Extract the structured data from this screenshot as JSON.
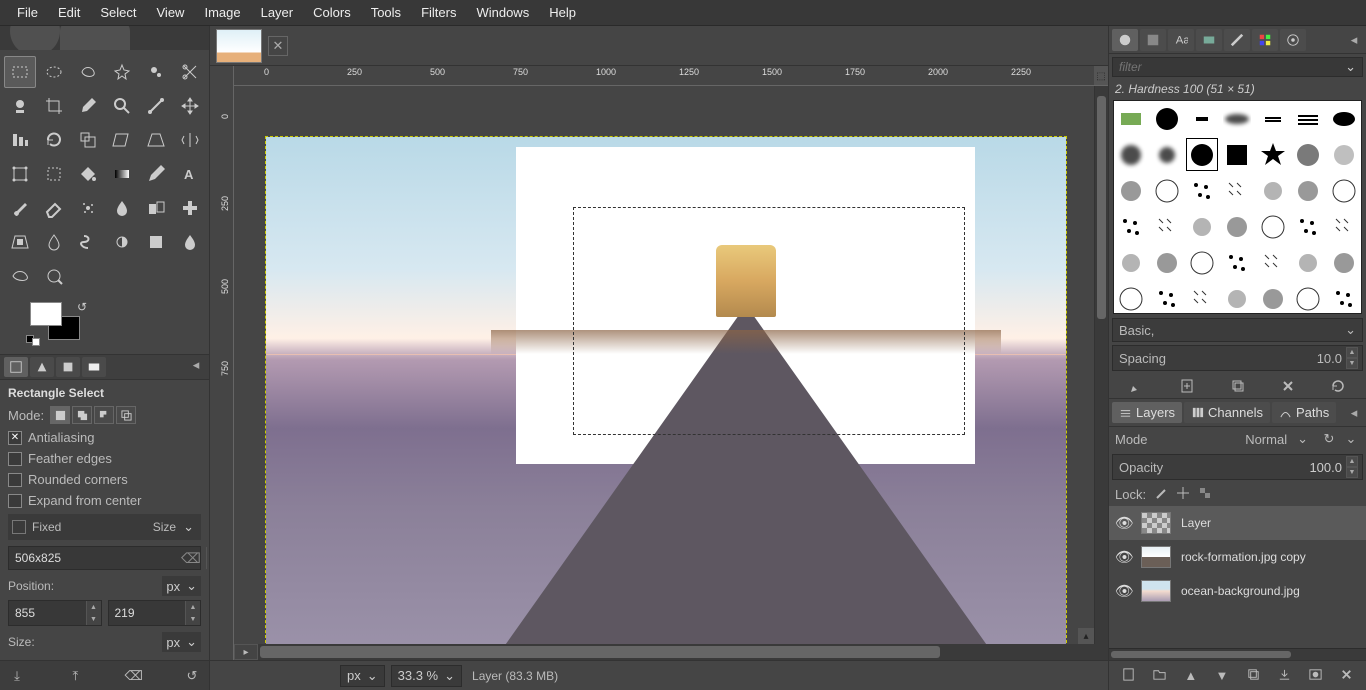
{
  "menu": {
    "items": [
      "File",
      "Edit",
      "Select",
      "View",
      "Image",
      "Layer",
      "Colors",
      "Tools",
      "Filters",
      "Windows",
      "Help"
    ]
  },
  "toolbox": {
    "tools": [
      "rectangle-select",
      "ellipse-select",
      "free-select",
      "fuzzy-select",
      "by-color-select",
      "scissors",
      "foreground-select",
      "crop",
      "color-picker",
      "zoom",
      "measure",
      "move",
      "align",
      "rotate",
      "scale",
      "shear",
      "perspective",
      "flip",
      "cage",
      "unified-transform",
      "bucket-fill",
      "gradient",
      "pencil",
      "text",
      "paintbrush",
      "eraser",
      "airbrush",
      "ink",
      "clone",
      "heal",
      "perspective-clone",
      "blur-sharpen",
      "smudge",
      "dodge-burn",
      "clone-2",
      "smudge-2",
      "warp",
      "path"
    ],
    "active": "rectangle-select",
    "fg_color": "#ffffff",
    "bg_color": "#000000"
  },
  "tool_options": {
    "tabs": [
      "tool-options",
      "device-status",
      "undo-history",
      "images"
    ],
    "active_tab": "tool-options",
    "title": "Rectangle Select",
    "mode_label": "Mode:",
    "antialiasing": {
      "label": "Antialiasing",
      "checked": true
    },
    "feather": {
      "label": "Feather edges",
      "checked": false
    },
    "rounded": {
      "label": "Rounded corners",
      "checked": false
    },
    "expand": {
      "label": "Expand from center",
      "checked": false
    },
    "fixed_label": "Fixed",
    "fixed_mode": "Size",
    "fixed_value": "506x825",
    "position_label": "Position:",
    "position_unit": "px",
    "position_x": "855",
    "position_y": "219",
    "size_label": "Size:",
    "size_unit": "px"
  },
  "canvas": {
    "ruler_h_labels": [
      "0",
      "250",
      "500",
      "750",
      "1000",
      "1250",
      "1500",
      "1750",
      "2000",
      "2250"
    ],
    "ruler_v_labels": [
      "0",
      "250",
      "500",
      "750"
    ]
  },
  "statusbar": {
    "unit": "px",
    "zoom": "33.3 %",
    "layer_info": "Layer (83.3 MB)"
  },
  "brushes_panel": {
    "tabs": [
      "brushes",
      "patterns",
      "fonts",
      "gradients-tab",
      "paint-dynamics",
      "palettes",
      "tool-presets"
    ],
    "filter_placeholder": "filter",
    "title": "2. Hardness 100 (51 × 51)",
    "preset_label": "Basic,",
    "spacing_label": "Spacing",
    "spacing_value": "10.0"
  },
  "layers_panel": {
    "tabs": [
      {
        "id": "layers",
        "label": "Layers"
      },
      {
        "id": "channels",
        "label": "Channels"
      },
      {
        "id": "paths",
        "label": "Paths"
      }
    ],
    "active_tab": "layers",
    "mode_label": "Mode",
    "mode_value": "Normal",
    "opacity_label": "Opacity",
    "opacity_value": "100.0",
    "lock_label": "Lock:",
    "layers": [
      {
        "name": "Layer",
        "thumb": "checker",
        "visible": true,
        "active": true
      },
      {
        "name": "rock-formation.jpg copy",
        "thumb": "rock",
        "visible": true,
        "active": false
      },
      {
        "name": "ocean-background.jpg",
        "thumb": "ocean-t",
        "visible": true,
        "active": false
      }
    ]
  }
}
